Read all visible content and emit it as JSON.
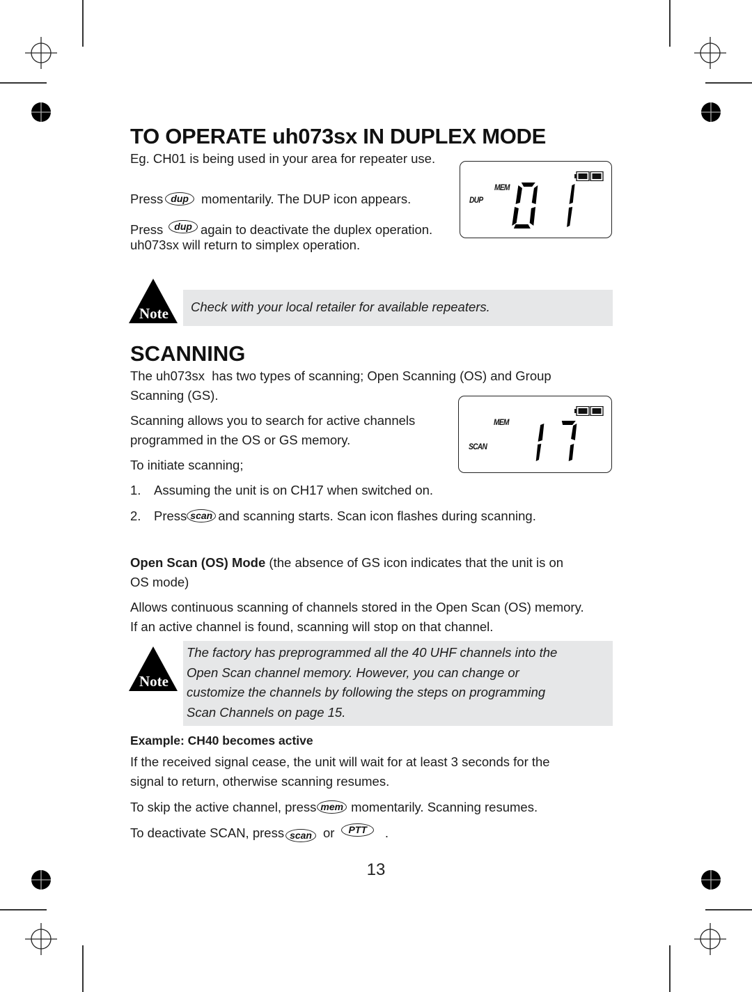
{
  "page": {
    "page_number": "13"
  },
  "duplex": {
    "title": "TO OPERATE uh073sx IN DUPLEX MODE",
    "intro": "Eg. CH01 is being used in your area for repeater use.",
    "step1_prefix": "Press",
    "step1_key": "dup",
    "step1_suffix": "momentarily. The DUP icon appears.",
    "step2_prefix": "Press",
    "step2_key": "dup",
    "step2_suffix": "again to deactivate the duplex operation.",
    "step2_line2": "uh073sx will return to simplex operation.",
    "lcd": {
      "mode_label": "DUP",
      "mem_label": "MEM",
      "channel": "01",
      "battery_icon": "battery-full-icon"
    },
    "note": {
      "icon_label": "Note",
      "text": "Check with your local retailer for available repeaters."
    }
  },
  "scanning": {
    "title": "SCANNING",
    "intro_line1": "The uh073sx  has two types of scanning; Open Scanning (OS) and Group",
    "intro_line2": "Scanning (GS).",
    "allows_line1": "Scanning allows you to search for active channels",
    "allows_line2": "programmed in the OS or GS memory.",
    "initiate": "To initiate scanning;",
    "lcd": {
      "mode_label": "SCAN",
      "mem_label": "MEM",
      "channel": "17",
      "battery_icon": "battery-full-icon"
    },
    "steps": [
      {
        "num": "1.",
        "text": "Assuming the unit is on CH17 when switched on."
      },
      {
        "num": "2.",
        "prefix": "Press",
        "key": "scan",
        "suffix": "and scanning starts. Scan icon flashes during scanning."
      }
    ],
    "os_mode": {
      "heading": "Open Scan (OS) Mode",
      "heading_rest": " (the absence of GS icon indicates that the unit is on",
      "line2": "OS mode)",
      "allows_line1": "Allows continuous scanning of channels stored in the Open Scan (OS) memory.",
      "allows_line2": "If an active channel is found, scanning will stop on that channel."
    },
    "note": {
      "icon_label": "Note",
      "lines": [
        "The factory has preprogrammed all the 40 UHF channels into the",
        "Open Scan channel memory. However, you can change or",
        "customize the channels by following the steps on programming",
        "Scan Channels on page 15."
      ]
    },
    "example": {
      "heading": "Example: CH40 becomes active",
      "line1": "If the received signal cease, the unit will wait for at least 3 seconds for the",
      "line2": "signal to return, otherwise scanning resumes.",
      "skip_prefix": "To skip the active channel, press",
      "skip_key": "mem",
      "skip_suffix": "momentarily. Scanning resumes.",
      "deactivate_prefix": "To deactivate SCAN, press",
      "deactivate_key1": "scan",
      "deactivate_or": "or",
      "deactivate_key2": "PTT",
      "deactivate_end": "."
    }
  }
}
